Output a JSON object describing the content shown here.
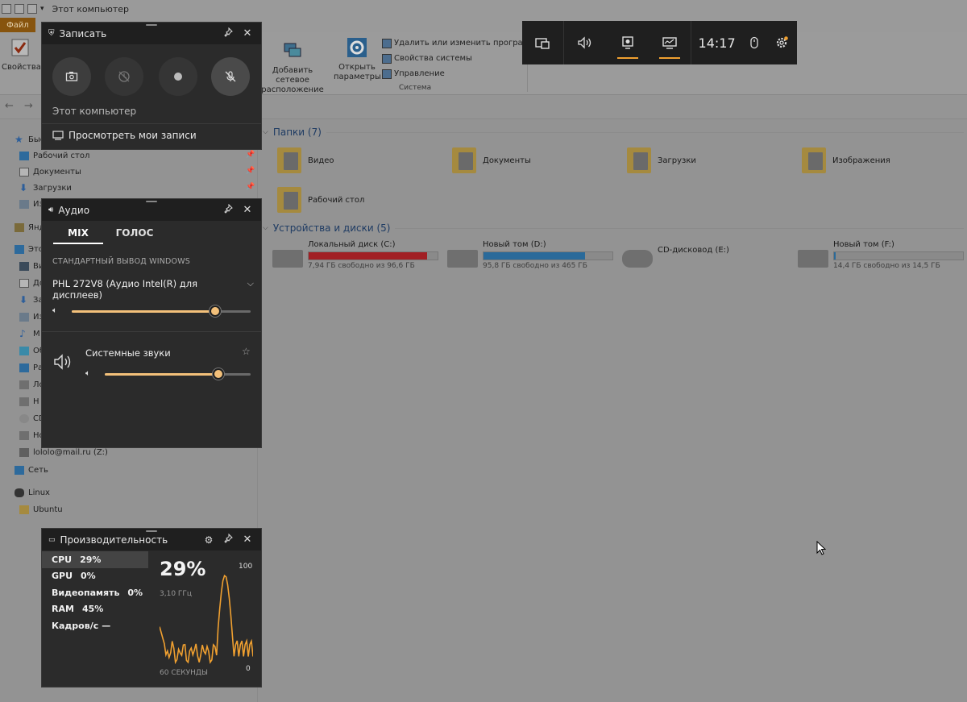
{
  "explorer": {
    "window_title": "Этот компьютер",
    "file_tab": "Файл",
    "ribbon": {
      "properties_label": "Свойства",
      "add_network_location": [
        "Добавить сетевое",
        "расположение"
      ],
      "open_settings": [
        "Открыть",
        "параметры"
      ],
      "uninstall_label": "Удалить или изменить программу",
      "system_props_label": "Свойства системы",
      "manage_label": "Управление",
      "group_system": "Система"
    },
    "nav": {
      "quick_access": "Быс",
      "items": [
        {
          "label": "Рабочий стол",
          "pinned": true
        },
        {
          "label": "Документы",
          "pinned": true
        },
        {
          "label": "Загрузки",
          "pinned": true
        },
        {
          "label": "Из",
          "pinned": false
        },
        {
          "label": "Янд",
          "pinned": false
        },
        {
          "label": "Это",
          "pinned": false
        },
        {
          "label": "Ви",
          "pinned": false
        },
        {
          "label": "До",
          "pinned": false
        },
        {
          "label": "За",
          "pinned": false
        },
        {
          "label": "Из",
          "pinned": false
        },
        {
          "label": "М",
          "pinned": false
        },
        {
          "label": "Об",
          "pinned": false
        },
        {
          "label": "Ра",
          "pinned": false
        },
        {
          "label": "Ло",
          "pinned": false
        },
        {
          "label": "Н",
          "pinned": false
        },
        {
          "label": "CD",
          "pinned": false
        },
        {
          "label": "Но",
          "pinned": false
        },
        {
          "label": "lololo@mail.ru (Z:)",
          "pinned": false
        },
        {
          "label": "Сеть",
          "pinned": false
        },
        {
          "label": "Linux",
          "pinned": false
        },
        {
          "label": "Ubuntu",
          "pinned": false
        }
      ]
    },
    "folders_header": "Папки (7)",
    "folders": [
      "Видео",
      "Документы",
      "Загрузки",
      "Изображения",
      "Рабочий стол"
    ],
    "drives_header": "Устройства и диски (5)",
    "drives": [
      {
        "name": "Локальный диск (C:)",
        "free": "7,94 ГБ свободно из 96,6 ГБ",
        "used_fraction": 0.92,
        "color": "#a11f24"
      },
      {
        "name": "Новый том (D:)",
        "free": "95,8 ГБ свободно из 465 ГБ",
        "used_fraction": 0.79,
        "color": "#2a6a9a"
      },
      {
        "name": "CD-дисковод (E:)",
        "free": "",
        "used_fraction": null,
        "color": ""
      },
      {
        "name": "Новый том (F:)",
        "free": "14,4 ГБ свободно из 14,5 ГБ",
        "used_fraction": 0.01,
        "color": "#2a6a9a"
      }
    ]
  },
  "gamebar": {
    "clock": "14:17",
    "capture": {
      "title": "Записать",
      "source": "Этот компьютер",
      "view_recordings": "Просмотреть мои записи"
    },
    "audio": {
      "title": "Аудио",
      "tabs": [
        "MIX",
        "ГОЛОС"
      ],
      "output_section": "СТАНДАРТНЫЙ ВЫВОД WINDOWS",
      "device": "PHL 272V8 (Аудио Intel(R) для дисплеев)",
      "master_volume": 0.8,
      "app_name": "Системные звуки",
      "app_volume": 0.78
    },
    "performance": {
      "title": "Производительность",
      "rows": [
        {
          "label": "CPU",
          "value": "29%"
        },
        {
          "label": "GPU",
          "value": "0%"
        },
        {
          "label": "Видеопамять",
          "value": "0%"
        },
        {
          "label": "RAM",
          "value": "45%"
        },
        {
          "label": "Кадров/с",
          "value": "—"
        }
      ],
      "big_value": "29%",
      "frequency": "3,10 ГГц",
      "axis_max": "100",
      "axis_min": "0",
      "time_label": "60 СЕКУНДЫ",
      "chart_color": "#f0a030"
    }
  }
}
